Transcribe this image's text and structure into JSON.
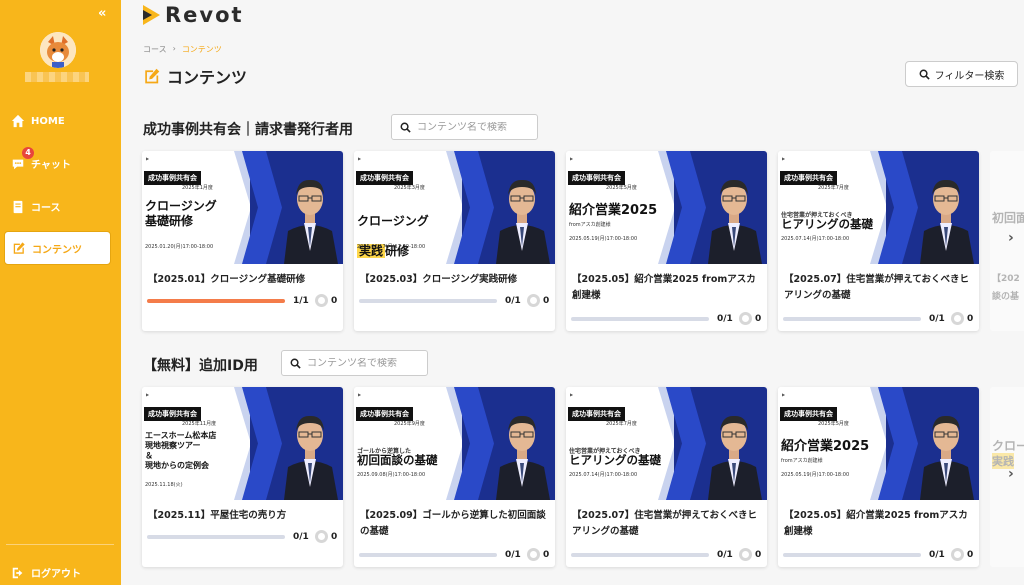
{
  "brand": {
    "logo_text": "Revot",
    "accent": "#f8b61b",
    "progress_color": "#f47c4a"
  },
  "sidebar": {
    "collapse_label": "«",
    "items": [
      {
        "label": "HOME",
        "icon": "home-icon"
      },
      {
        "label": "チャット",
        "icon": "chat-icon",
        "badge": "4"
      },
      {
        "label": "コース",
        "icon": "course-icon"
      },
      {
        "label": "コンテンツ",
        "icon": "edit-icon",
        "active": true
      }
    ],
    "logout_label": "ログアウト"
  },
  "breadcrumb": {
    "parent": "コース",
    "separator": "›",
    "current": "コンテンツ"
  },
  "page_title": "コンテンツ",
  "filter_button": "フィルター検索",
  "sections": [
    {
      "title": "成功事例共有会｜請求書発行者用",
      "search_placeholder": "コンテンツ名で検索",
      "cards": [
        {
          "tag": "成功事例共有会",
          "tag_date": "2025年1月度",
          "headline": "クロージング\n基礎研修",
          "date": "2025.01.20(月)17:00-18:00",
          "title": "【2025.01】クロージング基礎研修",
          "progress": 1.0,
          "count": "1/1",
          "likes": "0"
        },
        {
          "tag": "成功事例共有会",
          "tag_date": "2025年3月度",
          "headline_a": "クロージング",
          "headline_hl": "実践",
          "headline_b": "研修",
          "date": "2025.03.17(月)17:00-18:00",
          "title": "【2025.03】クロージング実践研修",
          "progress": 0,
          "count": "0/1",
          "likes": "0"
        },
        {
          "tag": "成功事例共有会",
          "tag_date": "2025年5月度",
          "headline": "紹介営業2025",
          "headline_sub": "fromアスカ創建様",
          "date": "2025.05.19(月)17:00-18:00",
          "title": "【2025.05】紹介営業2025 fromアスカ創建様",
          "progress": 0,
          "count": "0/1",
          "likes": "0"
        },
        {
          "tag": "成功事例共有会",
          "tag_date": "2025年7月度",
          "headline_pre": "住宅営業が押えておくべき",
          "headline": "ヒアリングの基礎",
          "date": "2025.07.14(月)17:00-18:00",
          "title": "【2025.07】住宅営業が押えておくべきヒアリングの基礎",
          "progress": 0,
          "count": "0/1",
          "likes": "0"
        }
      ],
      "peek": {
        "headline": "初回面",
        "title_a": "【202",
        "title_b": "談の基"
      }
    },
    {
      "title": "【無料】追加ID用",
      "search_placeholder": "コンテンツ名で検索",
      "cards": [
        {
          "tag": "成功事例共有会",
          "tag_date": "2025年11月度",
          "headline_small": "エースホーム松本店\n現地視察ツアー\n＆\n現地からの定例会",
          "date": "2025.11.18(火)",
          "title": "【2025.11】平屋住宅の売り方",
          "progress": 0,
          "count": "0/1",
          "likes": "0"
        },
        {
          "tag": "成功事例共有会",
          "tag_date": "2025年9月度",
          "headline_pre": "ゴールから逆算した",
          "headline": "初回面談の基礎",
          "date": "2025.09.08(月)17:00-18:00",
          "title": "【2025.09】ゴールから逆算した初回面談の基礎",
          "progress": 0,
          "count": "0/1",
          "likes": "0"
        },
        {
          "tag": "成功事例共有会",
          "tag_date": "2025年7月度",
          "headline_pre": "住宅営業が押えておくべき",
          "headline": "ヒアリングの基礎",
          "date": "2025.07.14(月)17:00-18:00",
          "title": "【2025.07】住宅営業が押えておくべきヒアリングの基礎",
          "progress": 0,
          "count": "0/1",
          "likes": "0"
        },
        {
          "tag": "成功事例共有会",
          "tag_date": "2025年5月度",
          "headline": "紹介営業2025",
          "headline_sub": "fromアスカ創建様",
          "date": "2025.05.19(月)17:00-18:00",
          "title": "【2025.05】紹介営業2025 fromアスカ創建様",
          "progress": 0,
          "count": "0/1",
          "likes": "0"
        }
      ],
      "peek": {
        "headline": "クロー",
        "hl": "実践"
      }
    }
  ],
  "carousel_next": "›"
}
